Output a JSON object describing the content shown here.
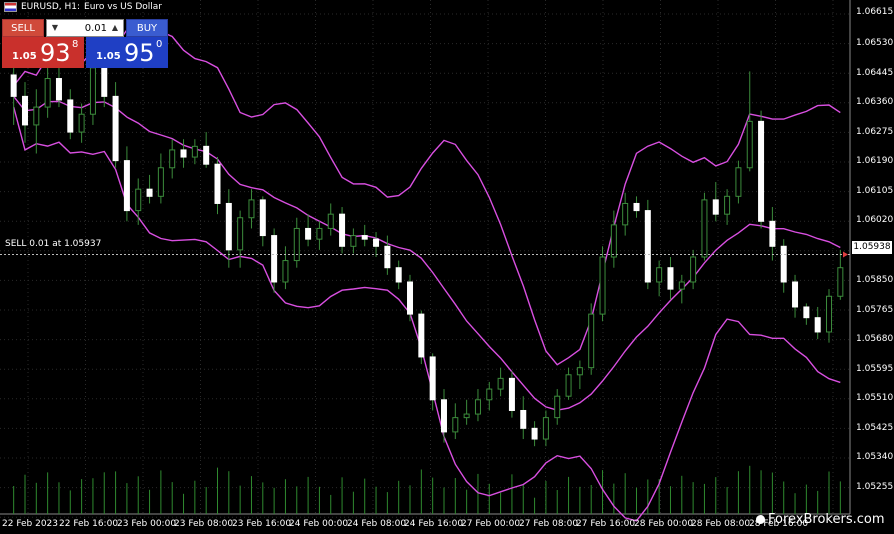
{
  "header": {
    "symbol": "EURUSD, H1:",
    "description": "Euro vs US Dollar"
  },
  "trade_panel": {
    "sell_label": "SELL",
    "buy_label": "BUY",
    "lot": "0.01",
    "sell_price_small": "1.05",
    "sell_price_big": "93",
    "sell_price_sup": "8",
    "buy_price_small": "1.05",
    "buy_price_big": "95",
    "buy_price_sup": "0"
  },
  "sell_line_label": "SELL 0.01 at 1.05937",
  "current_price_tag": "1.05938",
  "price_axis": [
    "1.06615",
    "1.06530",
    "1.06445",
    "1.06360",
    "1.06275",
    "1.06190",
    "1.06105",
    "1.06020",
    "1.05850",
    "1.05765",
    "1.05680",
    "1.05595",
    "1.05510",
    "1.05425",
    "1.05340",
    "1.05255"
  ],
  "time_axis": [
    "22 Feb 2023",
    "22 Feb 16:00",
    "23 Feb 00:00",
    "23 Feb 08:00",
    "23 Feb 16:00",
    "24 Feb 00:00",
    "24 Feb 08:00",
    "24 Feb 16:00",
    "27 Feb 00:00",
    "27 Feb 08:00",
    "27 Feb 16:00",
    "28 Feb 00:00",
    "28 Feb 08:00",
    "28 Feb 16:00"
  ],
  "brand": "ForexBrokers.com",
  "colors": {
    "background": "#000000",
    "up_candle": "#ffffff",
    "down_candle": "#ffffff",
    "wick": "#3c8c3c",
    "bollinger": "#d84fe0",
    "volume": "#2f8a2f",
    "grid": "#2a2a2a"
  },
  "chart_data": {
    "type": "candlestick",
    "symbol": "EURUSD",
    "timeframe": "H1",
    "ylim": [
      1.0521,
      1.0665
    ],
    "grid": true,
    "candles": [
      [
        1.0644,
        1.065,
        1.063,
        1.0638
      ],
      [
        1.0638,
        1.0642,
        1.0625,
        1.063
      ],
      [
        1.063,
        1.064,
        1.0622,
        1.0635
      ],
      [
        1.0635,
        1.0646,
        1.0632,
        1.0643
      ],
      [
        1.0643,
        1.0648,
        1.0635,
        1.0637
      ],
      [
        1.0637,
        1.064,
        1.0626,
        1.0628
      ],
      [
        1.0628,
        1.0636,
        1.0625,
        1.0633
      ],
      [
        1.0633,
        1.0652,
        1.063,
        1.0646
      ],
      [
        1.0646,
        1.0648,
        1.0635,
        1.0638
      ],
      [
        1.0638,
        1.0642,
        1.0618,
        1.062
      ],
      [
        1.062,
        1.0624,
        1.0603,
        1.0606
      ],
      [
        1.0606,
        1.0615,
        1.0602,
        1.0612
      ],
      [
        1.0612,
        1.0616,
        1.0608,
        1.061
      ],
      [
        1.061,
        1.0622,
        1.0608,
        1.0618
      ],
      [
        1.0618,
        1.0626,
        1.0615,
        1.0623
      ],
      [
        1.0623,
        1.0626,
        1.0618,
        1.0621
      ],
      [
        1.0621,
        1.0626,
        1.0619,
        1.0624
      ],
      [
        1.0624,
        1.0628,
        1.0618,
        1.0619
      ],
      [
        1.0619,
        1.0621,
        1.0605,
        1.0608
      ],
      [
        1.0608,
        1.0612,
        1.059,
        1.0595
      ],
      [
        1.0595,
        1.0606,
        1.059,
        1.0604
      ],
      [
        1.0604,
        1.0612,
        1.0601,
        1.0609
      ],
      [
        1.0609,
        1.061,
        1.0596,
        1.0599
      ],
      [
        1.0599,
        1.0601,
        1.0583,
        1.0586
      ],
      [
        1.0586,
        1.0596,
        1.0584,
        1.0592
      ],
      [
        1.0592,
        1.0604,
        1.059,
        1.0601
      ],
      [
        1.0601,
        1.0605,
        1.0596,
        1.0598
      ],
      [
        1.0598,
        1.0603,
        1.0595,
        1.0601
      ],
      [
        1.0601,
        1.0608,
        1.0599,
        1.0605
      ],
      [
        1.0605,
        1.0607,
        1.0594,
        1.0596
      ],
      [
        1.0596,
        1.0601,
        1.0594,
        1.0599
      ],
      [
        1.0599,
        1.0602,
        1.0596,
        1.0598
      ],
      [
        1.0598,
        1.06,
        1.0593,
        1.0596
      ],
      [
        1.0596,
        1.0599,
        1.0588,
        1.059
      ],
      [
        1.059,
        1.0592,
        1.0584,
        1.0586
      ],
      [
        1.0586,
        1.0588,
        1.0575,
        1.0577
      ],
      [
        1.0577,
        1.0578,
        1.0563,
        1.0565
      ],
      [
        1.0565,
        1.0566,
        1.055,
        1.0553
      ],
      [
        1.0553,
        1.0556,
        1.0541,
        1.0544
      ],
      [
        1.0544,
        1.0552,
        1.0542,
        1.0548
      ],
      [
        1.0548,
        1.0553,
        1.0546,
        1.0549
      ],
      [
        1.0549,
        1.0556,
        1.0547,
        1.0553
      ],
      [
        1.0553,
        1.0558,
        1.055,
        1.0556
      ],
      [
        1.0556,
        1.0562,
        1.0554,
        1.0559
      ],
      [
        1.0559,
        1.0561,
        1.0548,
        1.055
      ],
      [
        1.055,
        1.0554,
        1.0542,
        1.0545
      ],
      [
        1.0545,
        1.0547,
        1.054,
        1.0542
      ],
      [
        1.0542,
        1.055,
        1.054,
        1.0548
      ],
      [
        1.0548,
        1.0556,
        1.0546,
        1.0554
      ],
      [
        1.0554,
        1.0562,
        1.0553,
        1.056
      ],
      [
        1.056,
        1.0564,
        1.0556,
        1.0562
      ],
      [
        1.0562,
        1.058,
        1.056,
        1.0577
      ],
      [
        1.0577,
        1.0596,
        1.0575,
        1.0593
      ],
      [
        1.0593,
        1.0606,
        1.059,
        1.0602
      ],
      [
        1.0602,
        1.0611,
        1.0599,
        1.0608
      ],
      [
        1.0608,
        1.061,
        1.0604,
        1.0606
      ],
      [
        1.0606,
        1.0609,
        1.0584,
        1.0586
      ],
      [
        1.0586,
        1.0592,
        1.0582,
        1.059
      ],
      [
        1.059,
        1.0593,
        1.0581,
        1.0584
      ],
      [
        1.0584,
        1.0588,
        1.058,
        1.0586
      ],
      [
        1.0586,
        1.0595,
        1.0584,
        1.0593
      ],
      [
        1.0593,
        1.0611,
        1.0592,
        1.0609
      ],
      [
        1.0609,
        1.0614,
        1.0603,
        1.0605
      ],
      [
        1.0605,
        1.0612,
        1.0602,
        1.061
      ],
      [
        1.061,
        1.062,
        1.0608,
        1.0618
      ],
      [
        1.0618,
        1.0645,
        1.0617,
        1.0631
      ],
      [
        1.0631,
        1.0634,
        1.0601,
        1.0603
      ],
      [
        1.0603,
        1.0607,
        1.0592,
        1.0596
      ],
      [
        1.0596,
        1.0598,
        1.0583,
        1.0586
      ],
      [
        1.0586,
        1.0588,
        1.0576,
        1.0579
      ],
      [
        1.0579,
        1.058,
        1.0574,
        1.0576
      ],
      [
        1.0576,
        1.0579,
        1.057,
        1.0572
      ],
      [
        1.0572,
        1.0584,
        1.0569,
        1.0582
      ],
      [
        1.0582,
        1.0595,
        1.0581,
        1.059
      ]
    ],
    "volume_note": "histogram below candles",
    "bollinger_bands": "upper, middle, lower envelopes"
  }
}
